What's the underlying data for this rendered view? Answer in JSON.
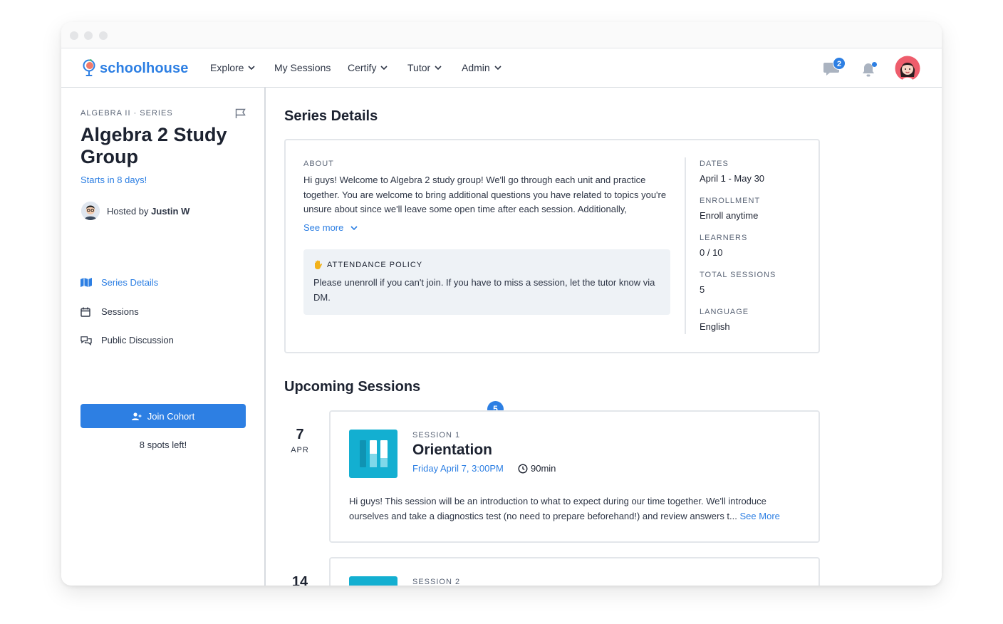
{
  "brand": {
    "name": "schoolhouse",
    "accent": "#2d7fe3"
  },
  "nav": {
    "items": [
      {
        "label": "Explore",
        "dropdown": true
      },
      {
        "label": "My Sessions",
        "dropdown": false
      },
      {
        "label": "Certify",
        "dropdown": true
      },
      {
        "label": "Tutor",
        "dropdown": true
      },
      {
        "label": "Admin",
        "dropdown": true
      }
    ],
    "messages_badge": "2",
    "icons": [
      "chat-icon",
      "bell-icon",
      "avatar"
    ]
  },
  "sidebar": {
    "eyebrow": "ALGEBRA II · SERIES",
    "title": "Algebra 2 Study Group",
    "starts": "Starts in 8 days!",
    "host_prefix": "Hosted by",
    "host_name": "Justin W",
    "links": [
      {
        "label": "Series Details",
        "icon": "map-icon",
        "active": true
      },
      {
        "label": "Sessions",
        "icon": "calendar-icon",
        "active": false
      },
      {
        "label": "Public Discussion",
        "icon": "discussion-icon",
        "active": false
      }
    ],
    "join_label": "Join Cohort",
    "spots": "8 spots left!"
  },
  "details": {
    "heading": "Series Details",
    "about_label": "ABOUT",
    "about_text": "Hi guys! Welcome to Algebra 2 study group! We'll go through each unit and practice together. You are welcome to bring additional questions you have related to topics you're unsure about since we'll leave some open time after each session. Additionally,",
    "see_more": "See more",
    "policy_label": "ATTENDANCE POLICY",
    "policy_text": "Please unenroll if you can't join. If you have to miss a session, let the tutor know via DM.",
    "meta": [
      {
        "label": "DATES",
        "value": "April 1 - May 30"
      },
      {
        "label": "ENROLLMENT",
        "value": "Enroll anytime"
      },
      {
        "label": "LEARNERS",
        "value": "0 / 10"
      },
      {
        "label": "TOTAL SESSIONS",
        "value": "5"
      },
      {
        "label": "LANGUAGE",
        "value": "English"
      }
    ]
  },
  "upcoming": {
    "heading": "Upcoming Sessions",
    "count": "5",
    "sessions": [
      {
        "day": "7",
        "month": "APR",
        "label": "SESSION 1",
        "title": "Orientation",
        "time": "Friday April 7, 3:00PM",
        "duration": "90min",
        "description": "Hi guys! This session will be an introduction to what to expect during our time together. We'll introduce ourselves and take a diagnostics test (no need to prepare beforehand!) and review answers t...",
        "see_more": "See More"
      },
      {
        "day": "14",
        "label": "SESSION 2"
      }
    ]
  }
}
